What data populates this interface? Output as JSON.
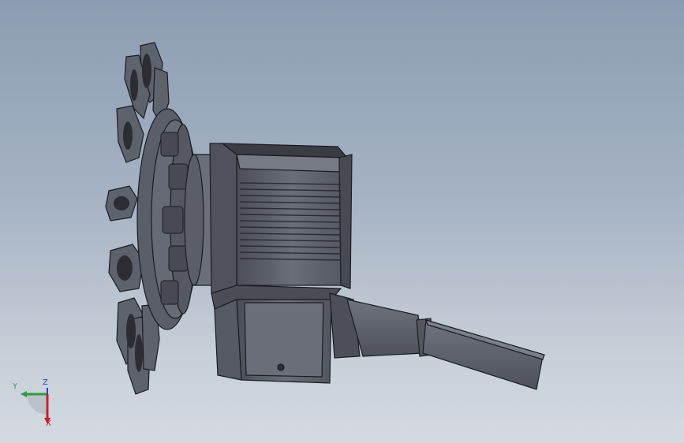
{
  "viewport": {
    "background_top": "#8c9cb2",
    "background_bottom": "#d4dae0",
    "model_fill": "#5d616d",
    "model_dark": "#3f424b",
    "edge_color": "#1b1c20"
  },
  "triad": {
    "y_label": "Y",
    "z_label": "Z",
    "x_label": "X",
    "y_color": "#2e9c3a",
    "z_color": "#2c3fd0",
    "x_color": "#c8202a"
  }
}
